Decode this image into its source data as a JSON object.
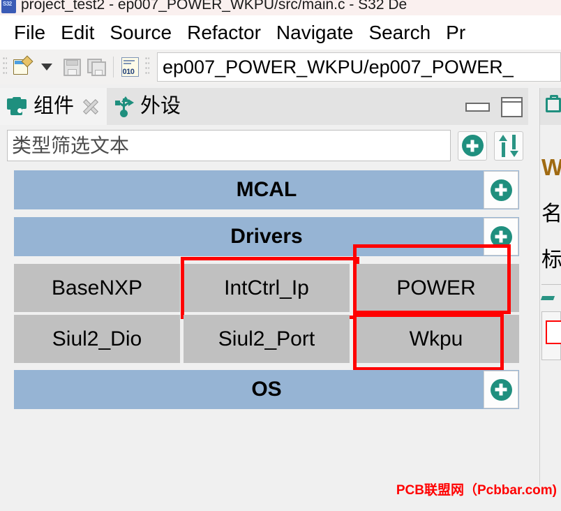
{
  "window": {
    "title": "project_test2 - ep007_POWER_WKPU/src/main.c - S32 De",
    "app_icon": "s32-design-studio-icon"
  },
  "menubar": {
    "items": [
      {
        "label": "File"
      },
      {
        "label": "Edit"
      },
      {
        "label": "Source"
      },
      {
        "label": "Refactor"
      },
      {
        "label": "Navigate"
      },
      {
        "label": "Search"
      },
      {
        "label": "Pr"
      }
    ]
  },
  "toolbar": {
    "new_icon": "new-file-icon",
    "dropdown_icon": "chevron-down-icon",
    "save_icon": "save-icon",
    "save_all_icon": "save-all-icon",
    "hex_icon": "hex-editor-icon",
    "hex_icon_label": "010",
    "path_value": "ep007_POWER_WKPU/ep007_POWER_"
  },
  "left_view": {
    "tabs": [
      {
        "label": "组件",
        "icon": "components-icon",
        "active": true,
        "closable": true
      },
      {
        "label": "外设",
        "icon": "usb-peripherals-icon",
        "active": false,
        "closable": false
      }
    ],
    "minimize_icon": "minimize-icon",
    "maximize_icon": "maximize-icon",
    "filter": {
      "placeholder": "类型筛选文本",
      "value": ""
    },
    "filter_buttons": [
      {
        "name": "add-component-button",
        "icon": "plus-circle-icon"
      },
      {
        "name": "sort-button",
        "icon": "sort-arrows-icon"
      }
    ],
    "groups": [
      {
        "title": "MCAL",
        "add_icon": "plus-circle-icon",
        "items": []
      },
      {
        "title": "Drivers",
        "add_icon": "plus-circle-icon",
        "items": [
          {
            "label": "BaseNXP",
            "highlighted": false
          },
          {
            "label": "IntCtrl_Ip",
            "highlighted": true
          },
          {
            "label": "POWER",
            "highlighted": true
          },
          {
            "label": "Siul2_Dio",
            "highlighted": false
          },
          {
            "label": "Siul2_Port",
            "highlighted": false
          },
          {
            "label": "Wkpu",
            "highlighted": true
          }
        ]
      },
      {
        "title": "OS",
        "add_icon": "plus-circle-icon",
        "items": []
      }
    ]
  },
  "right_view": {
    "tab_icon": "clipboard-icon",
    "clipped_heading": "W",
    "clipped_line1": "名",
    "clipped_line2": "标"
  },
  "watermark": {
    "text": "PCB联盟网（Pcbbar.com)"
  },
  "colors": {
    "group_header": "#96b4d4",
    "tile": "#c0c0c0",
    "highlight": "#ff0000",
    "accent_green": "#1f8f7e",
    "titlebar": "#faf0ef"
  }
}
